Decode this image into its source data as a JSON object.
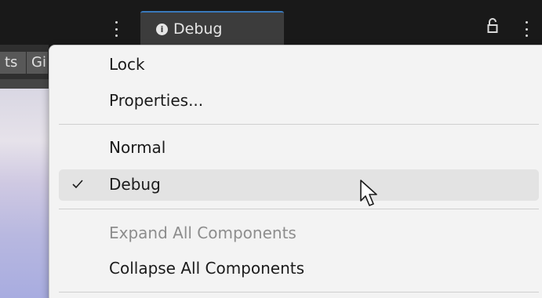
{
  "header": {
    "active_tab": {
      "label": "Debug",
      "icon": "info-icon",
      "icon_glyph": "i"
    },
    "left_tabs": [
      "ts",
      "Gi"
    ],
    "colors": {
      "accent": "#3a79bb",
      "tab_background": "#3c3c3c"
    }
  },
  "menu": {
    "items": [
      {
        "label": "Lock",
        "checked": false,
        "enabled": true
      },
      {
        "label": "Properties...",
        "checked": false,
        "enabled": true
      },
      {
        "label": "Normal",
        "checked": false,
        "enabled": true
      },
      {
        "label": "Debug",
        "checked": true,
        "enabled": true,
        "hovered": true
      },
      {
        "label": "Expand All Components",
        "checked": false,
        "enabled": false
      },
      {
        "label": "Collapse All Components",
        "checked": false,
        "enabled": true
      }
    ],
    "colors": {
      "background": "#f3f3f3",
      "hover": "#e3e3e3",
      "text": "#1b1b1b",
      "disabled_text": "#8d8d8d"
    }
  }
}
